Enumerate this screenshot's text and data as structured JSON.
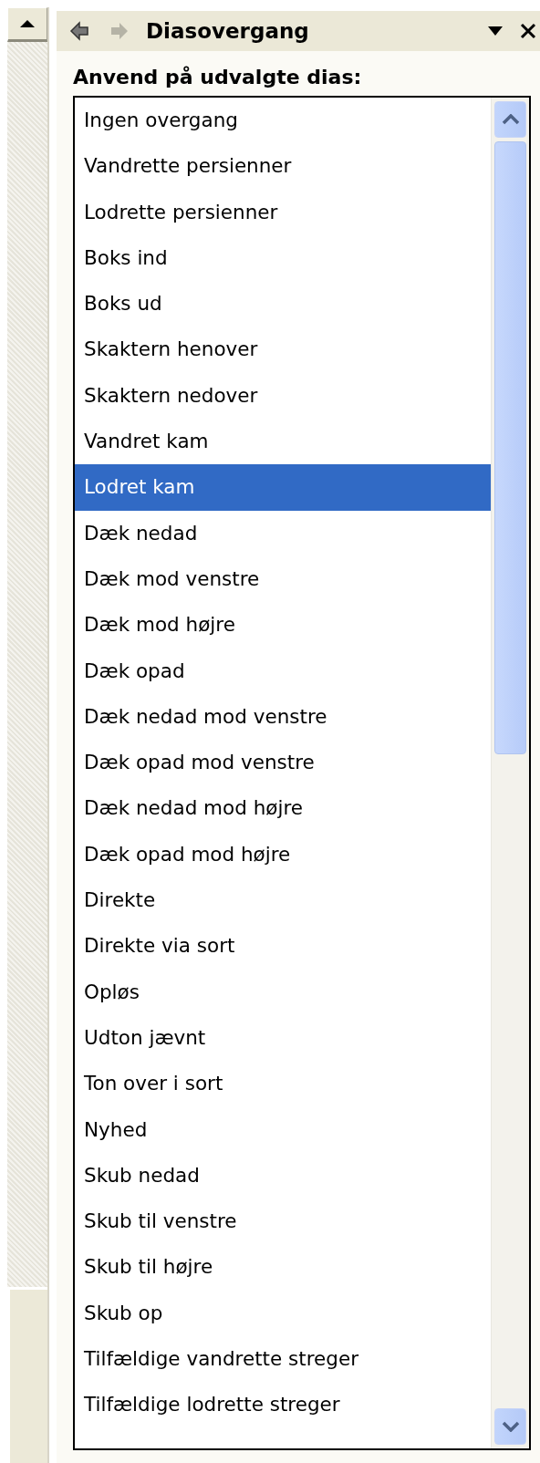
{
  "pane": {
    "title": "Diasovergang"
  },
  "label": "Anvend på udvalgte dias:",
  "transitions": [
    {
      "name": "Ingen overgang",
      "selected": false
    },
    {
      "name": "Vandrette persienner",
      "selected": false
    },
    {
      "name": "Lodrette persienner",
      "selected": false
    },
    {
      "name": "Boks ind",
      "selected": false
    },
    {
      "name": "Boks ud",
      "selected": false
    },
    {
      "name": "Skaktern henover",
      "selected": false
    },
    {
      "name": "Skaktern nedover",
      "selected": false
    },
    {
      "name": "Vandret kam",
      "selected": false
    },
    {
      "name": "Lodret kam",
      "selected": true
    },
    {
      "name": "Dæk nedad",
      "selected": false
    },
    {
      "name": "Dæk mod venstre",
      "selected": false
    },
    {
      "name": "Dæk mod højre",
      "selected": false
    },
    {
      "name": "Dæk opad",
      "selected": false
    },
    {
      "name": "Dæk nedad mod venstre",
      "selected": false
    },
    {
      "name": "Dæk opad mod venstre",
      "selected": false
    },
    {
      "name": "Dæk nedad mod højre",
      "selected": false
    },
    {
      "name": "Dæk opad mod højre",
      "selected": false
    },
    {
      "name": "Direkte",
      "selected": false
    },
    {
      "name": "Direkte via sort",
      "selected": false
    },
    {
      "name": "Opløs",
      "selected": false
    },
    {
      "name": "Udton jævnt",
      "selected": false
    },
    {
      "name": "Ton over i sort",
      "selected": false
    },
    {
      "name": "Nyhed",
      "selected": false
    },
    {
      "name": "Skub nedad",
      "selected": false
    },
    {
      "name": "Skub til venstre",
      "selected": false
    },
    {
      "name": "Skub til højre",
      "selected": false
    },
    {
      "name": "Skub op",
      "selected": false
    },
    {
      "name": "Tilfældige vandrette streger",
      "selected": false
    },
    {
      "name": "Tilfældige lodrette streger",
      "selected": false
    }
  ]
}
